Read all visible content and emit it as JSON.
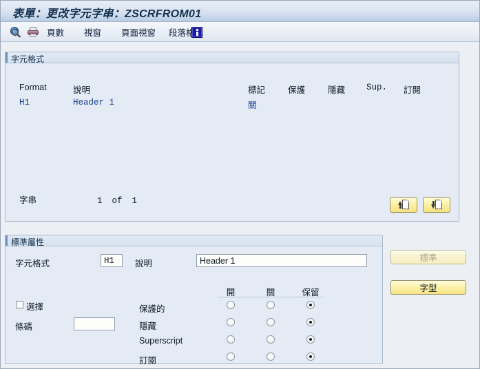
{
  "window": {
    "title": "表單：更改字元字串：ZSCRFROM01"
  },
  "toolbar": {
    "items": [
      {
        "name": "display-change-icon",
        "label": ""
      },
      {
        "name": "print-icon",
        "label": ""
      },
      {
        "name": "pages",
        "label": "頁數"
      },
      {
        "name": "windows",
        "label": "視窗"
      },
      {
        "name": "page-windows",
        "label": "頁面視窗"
      },
      {
        "name": "paragraph-format",
        "label": "段落格式"
      },
      {
        "name": "info-icon",
        "label": ""
      }
    ]
  },
  "list_panel": {
    "group_title": "字元格式",
    "columns": [
      {
        "key": "format",
        "label": "Format"
      },
      {
        "key": "description",
        "label": "說明"
      },
      {
        "key": "marker",
        "label": "標記"
      },
      {
        "key": "protect",
        "label": "保護"
      },
      {
        "key": "hidden",
        "label": "隱藏"
      },
      {
        "key": "sup",
        "label": "Sup."
      },
      {
        "key": "subscript",
        "label": "訂閱"
      }
    ],
    "rows": [
      {
        "format": "H1",
        "description": "Header 1",
        "marker": "關",
        "protect": "",
        "hidden": "",
        "sup": "",
        "subscript": ""
      }
    ],
    "counter": {
      "label": "字串",
      "current": "1",
      "of": "of",
      "total": "1"
    },
    "buttons": [
      {
        "name": "insert-string-button",
        "icon": "document-up-icon"
      },
      {
        "name": "delete-string-button",
        "icon": "document-down-icon"
      }
    ]
  },
  "attributes_panel": {
    "group_title": "標準屬性",
    "character_format": {
      "label": "字元格式",
      "value": "H1"
    },
    "description": {
      "label": "說明",
      "value": "Header 1",
      "placeholder": ""
    },
    "select_checkbox": {
      "label": "選擇",
      "checked": false
    },
    "barcode": {
      "label": "條碼",
      "value": "",
      "placeholder": ""
    },
    "radio_columns": [
      "開",
      "關",
      "保留"
    ],
    "radio_rows": [
      {
        "label": "保護的",
        "selected": 2
      },
      {
        "label": "隱藏",
        "selected": 2
      },
      {
        "label": "Superscript",
        "selected": 2
      },
      {
        "label": "訂閱",
        "selected": 2
      }
    ]
  },
  "side_buttons": [
    {
      "name": "standard-button",
      "label": "標準",
      "enabled": false
    },
    {
      "name": "font-button",
      "label": "字型",
      "enabled": true
    }
  ],
  "colors": {
    "title_text": "#13304f",
    "data_text": "#1b3f8f",
    "panel_bg": "#e4ebf4",
    "page_bg": "#eceff4",
    "accent": "#6d93c0",
    "button_yellow": "#f6e27f"
  }
}
